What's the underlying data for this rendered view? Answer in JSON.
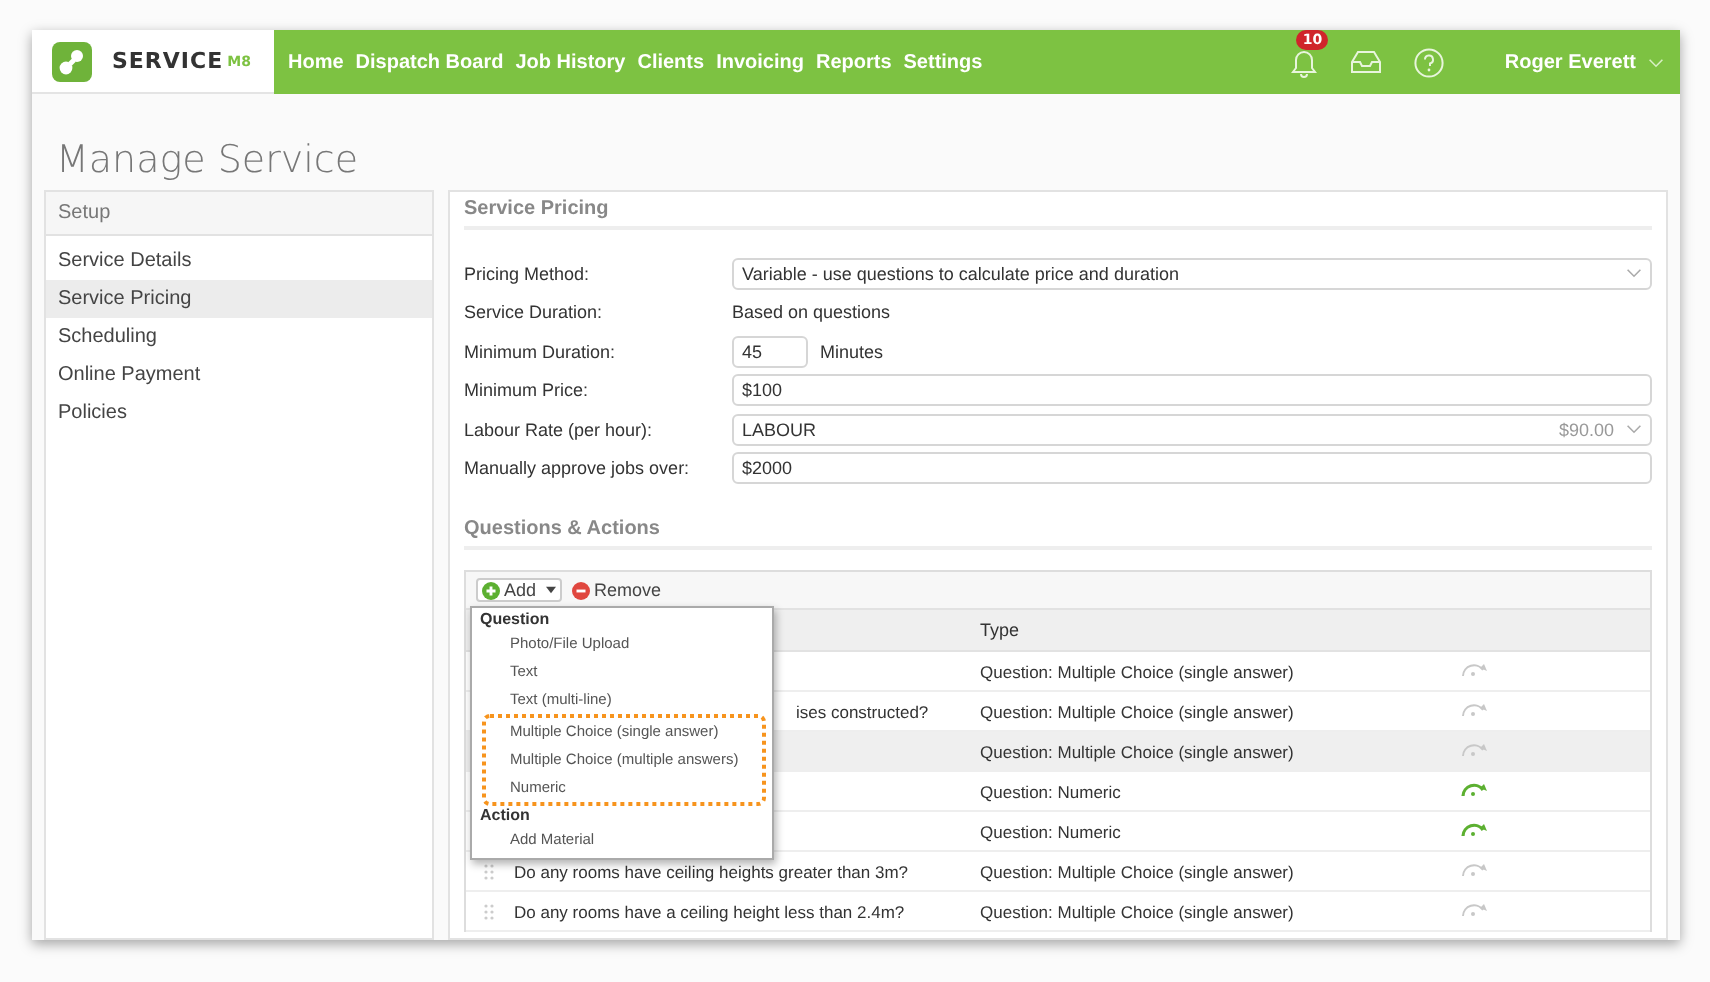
{
  "header": {
    "logo_text": "SERVICE",
    "logo_suffix": "M8",
    "nav": [
      {
        "label": "Home"
      },
      {
        "label": "Dispatch Board"
      },
      {
        "label": "Job History"
      },
      {
        "label": "Clients"
      },
      {
        "label": "Invoicing"
      },
      {
        "label": "Reports"
      },
      {
        "label": "Settings"
      }
    ],
    "notifications_badge": "10",
    "user_name": "Roger Everett"
  },
  "page_title": "Manage Service",
  "sidebar": {
    "heading": "Setup",
    "items": [
      {
        "label": "Service Details",
        "selected": false
      },
      {
        "label": "Service Pricing",
        "selected": true
      },
      {
        "label": "Scheduling",
        "selected": false
      },
      {
        "label": "Online Payment",
        "selected": false
      },
      {
        "label": "Policies",
        "selected": false
      }
    ]
  },
  "pricing": {
    "heading": "Service Pricing",
    "fields": [
      {
        "kind": "select",
        "label": "Pricing Method:",
        "value": "Variable - use questions to calculate price and duration"
      },
      {
        "kind": "static",
        "label": "Service Duration:",
        "value": "Based on questions"
      },
      {
        "kind": "short",
        "label": "Minimum Duration:",
        "value": "45",
        "unit": "Minutes"
      },
      {
        "kind": "input",
        "label": "Minimum Price:",
        "value": "$100"
      },
      {
        "kind": "select",
        "label": "Labour Rate (per hour):",
        "value": "LABOUR",
        "note": "$90.00"
      },
      {
        "kind": "input",
        "label": "Manually approve jobs over:",
        "value": "$2000"
      }
    ]
  },
  "questions": {
    "heading": "Questions & Actions",
    "add_label": "Add",
    "remove_label": "Remove",
    "column_type": "Type",
    "rows": [
      {
        "type": "Question: Multiple Choice (single answer)",
        "active": false,
        "selected": false
      },
      {
        "question": "ises constructed?",
        "cut": true,
        "type": "Question: Multiple Choice (single answer)",
        "active": false,
        "selected": false
      },
      {
        "type": "Question: Multiple Choice (single answer)",
        "active": false,
        "selected": true
      },
      {
        "type": "Question: Numeric",
        "active": true,
        "selected": false
      },
      {
        "type": "Question: Numeric",
        "active": true,
        "selected": false
      },
      {
        "question": "Do any rooms have ceiling heights greater than 3m?",
        "cut": false,
        "type": "Question: Multiple Choice (single answer)",
        "active": false,
        "selected": false
      },
      {
        "question": "Do any rooms have a ceiling height less than 2.4m?",
        "cut": false,
        "type": "Question: Multiple Choice (single answer)",
        "active": false,
        "selected": false
      }
    ],
    "menu": {
      "groups": [
        {
          "heading": "Question",
          "items": [
            {
              "label": "Photo/File Upload",
              "highlighted": false
            },
            {
              "label": "Text",
              "highlighted": false
            },
            {
              "label": "Text (multi-line)",
              "highlighted": false
            },
            {
              "label": "Multiple Choice (single answer)",
              "highlighted": true
            },
            {
              "label": "Multiple Choice (multiple answers)",
              "highlighted": true
            },
            {
              "label": "Numeric",
              "highlighted": true
            }
          ]
        },
        {
          "heading": "Action",
          "items": [
            {
              "label": "Add Material",
              "highlighted": false
            }
          ]
        }
      ]
    }
  }
}
